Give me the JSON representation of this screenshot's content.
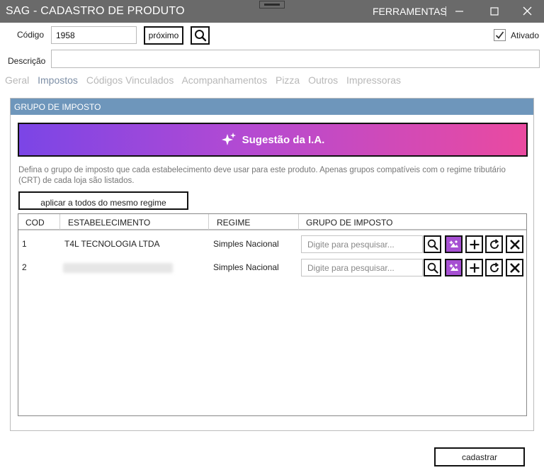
{
  "window": {
    "title": "SAG - CADASTRO DE PRODUTO",
    "menu": "FERRAMENTAS"
  },
  "form": {
    "codigo_label": "Código",
    "codigo_value": "1958",
    "proximo_label": "próximo",
    "ativado_label": "Ativado",
    "ativado_checked": true,
    "descricao_label": "Descrição",
    "descricao_value": ""
  },
  "tabs": [
    "Geral",
    "Impostos",
    "Códigos Vinculados",
    "Acompanhamentos",
    "Pizza",
    "Outros",
    "Impressoras"
  ],
  "active_tab": "Impostos",
  "group": {
    "header": "GRUPO DE IMPOSTO",
    "ia_label": "Sugestão da I.A.",
    "description": "Defina o grupo de imposto que cada estabelecimento deve usar para este produto. Apenas grupos compatíveis com o regime tributário (CRT) de cada loja são listados.",
    "apply_label": "aplicar a todos do mesmo regime"
  },
  "table": {
    "columns": [
      "COD",
      "ESTABELECIMENTO",
      "REGIME",
      "GRUPO DE IMPOSTO"
    ],
    "rows": [
      {
        "cod": "1",
        "estabelecimento": "T4L TECNOLOGIA LTDA",
        "regime": "Simples Nacional",
        "placeholder": "Digite para pesquisar...",
        "blurred": false
      },
      {
        "cod": "2",
        "estabelecimento": "",
        "regime": "Simples Nacional",
        "placeholder": "Digite para pesquisar...",
        "blurred": true
      }
    ]
  },
  "footer": {
    "submit_label": "cadastrar"
  },
  "colors": {
    "titlebar": "#6a6a6a",
    "group_header": "#6e96bb",
    "ia_gradient_start": "#7b45e6",
    "ia_gradient_end": "#ea4aa0",
    "ia_button": "#a64fd2",
    "active_tab": "#7d8fa6"
  }
}
